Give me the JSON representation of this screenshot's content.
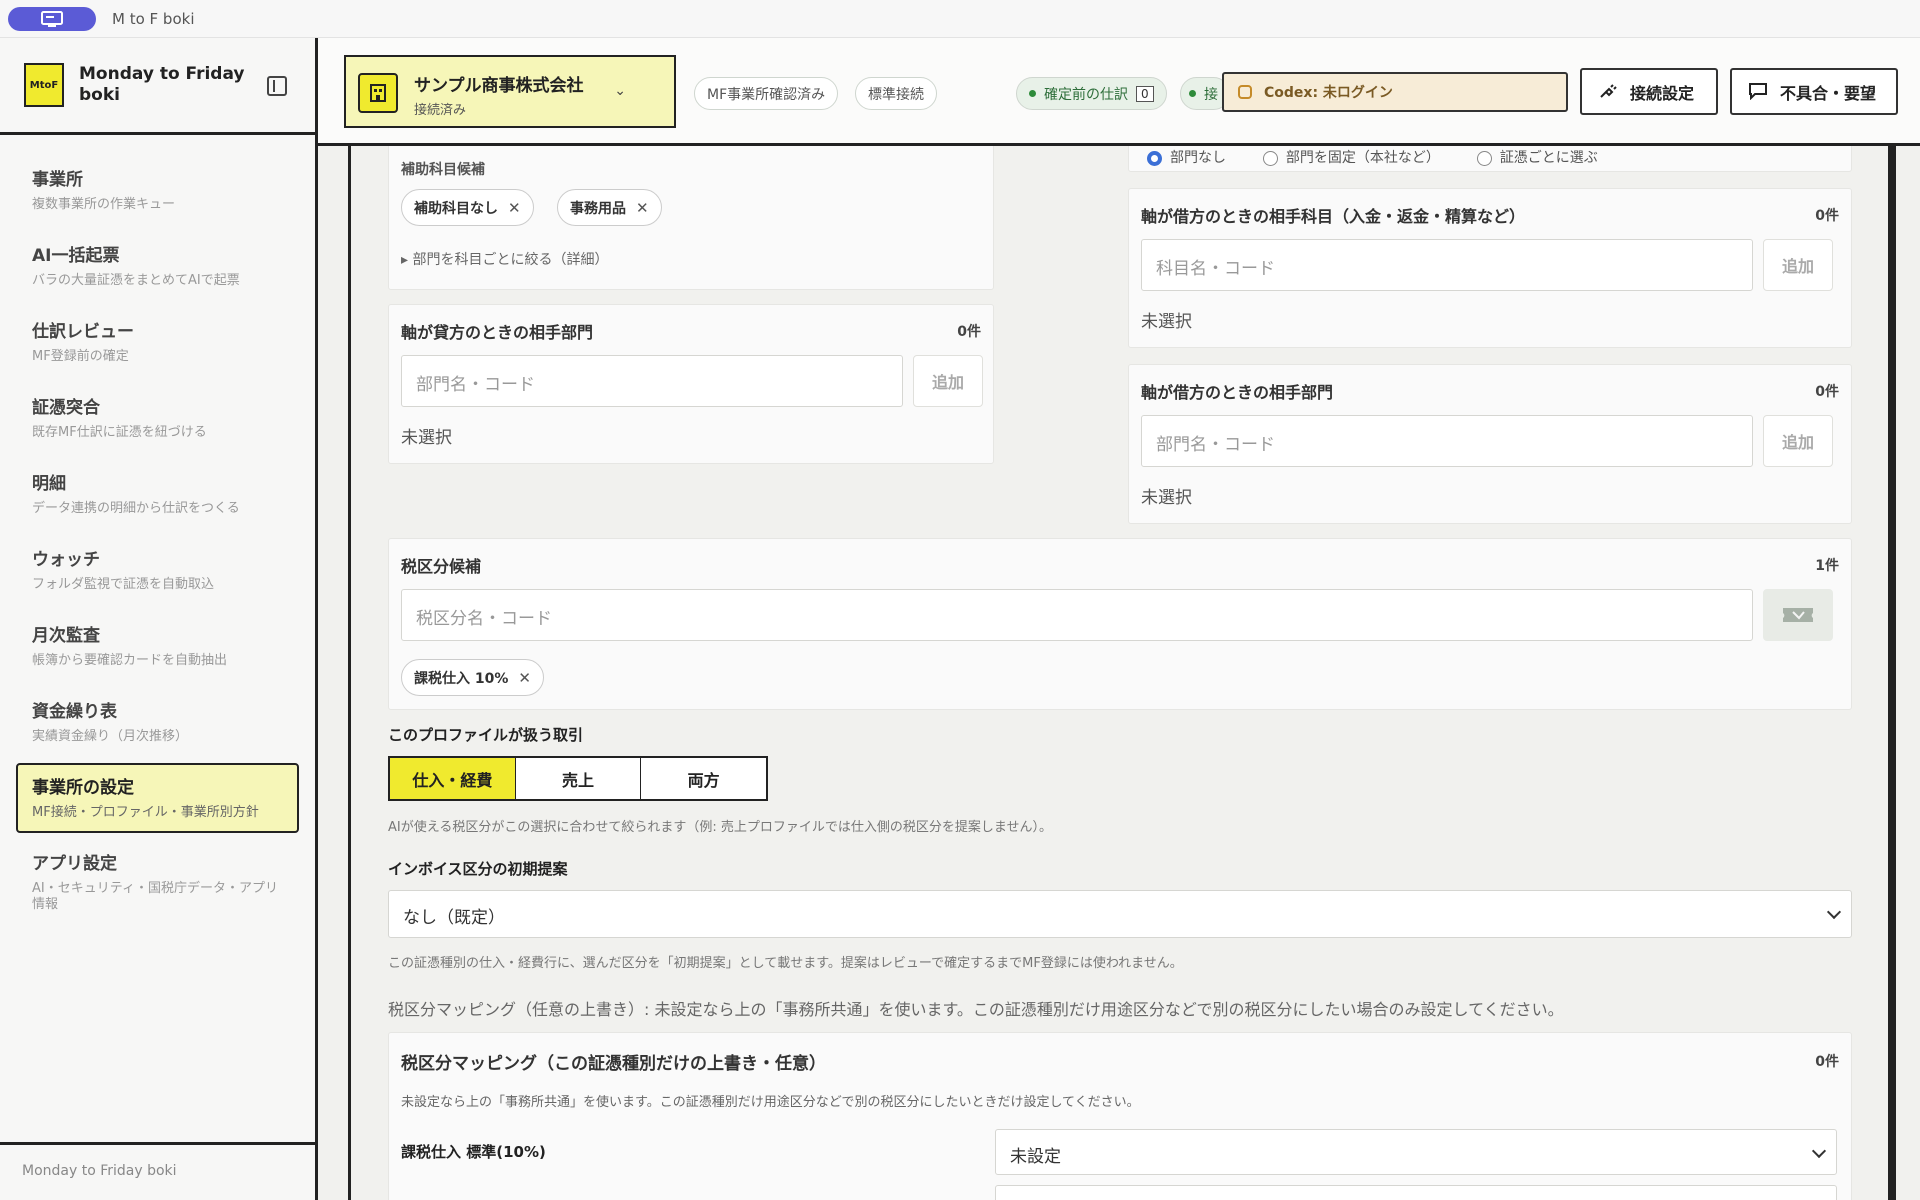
{
  "app": {
    "title": "M to F boki"
  },
  "sidebar": {
    "logo_text": "MtoF",
    "title": "Monday to Friday boki",
    "items": [
      {
        "label": "事業所",
        "sub": "複数事業所の作業キュー"
      },
      {
        "label": "AI一括起票",
        "sub": "バラの大量証憑をまとめてAIで起票"
      },
      {
        "label": "仕訳レビュー",
        "sub": "MF登録前の確定"
      },
      {
        "label": "証憑突合",
        "sub": "既存MF仕訳に証憑を紐づける"
      },
      {
        "label": "明細",
        "sub": "データ連携の明細から仕訳をつくる"
      },
      {
        "label": "ウォッチ",
        "sub": "フォルダ監視で証憑を自動取込"
      },
      {
        "label": "月次監査",
        "sub": "帳簿から要確認カードを自動抽出"
      },
      {
        "label": "資金繰り表",
        "sub": "実績資金繰り（月次推移）"
      },
      {
        "label": "事業所の設定",
        "sub": "MF接続・プロファイル・事業所別方針"
      },
      {
        "label": "アプリ設定",
        "sub": "AI・セキュリティ・国税庁データ・アプリ情報"
      }
    ],
    "footer": "Monday to Friday boki"
  },
  "header": {
    "company_name": "サンプル商事株式会社",
    "company_status": "接続済み",
    "pill_mf": "MF事業所確認済み",
    "pill_std": "標準接続",
    "pill_pending": "確定前の仕訳",
    "pill_pending_count": "0",
    "pill_cut": "接",
    "codex": "Codex: 未ログイン",
    "btn_connect": "接続設定",
    "btn_report": "不具合・要望"
  },
  "content": {
    "radio_options": [
      "部門なし",
      "部門を固定（本社など）",
      "証憑ごとに選ぶ"
    ],
    "sub_account_label": "補助科目候補",
    "sub_account_chips": [
      "補助科目なし",
      "事務用品"
    ],
    "dept_detail_link": "▸ 部門を科目ごとに絞る（詳細）",
    "credit_dept": {
      "label": "軸が貸方のときの相手部門",
      "count": "0件",
      "placeholder": "部門名・コード",
      "add": "追加",
      "unselected": "未選択"
    },
    "debit_account": {
      "label": "軸が借方のときの相手科目（入金・返金・精算など）",
      "count": "0件",
      "placeholder": "科目名・コード",
      "add": "追加",
      "unselected": "未選択"
    },
    "debit_dept": {
      "label": "軸が借方のときの相手部門",
      "count": "0件",
      "placeholder": "部門名・コード",
      "add": "追加",
      "unselected": "未選択"
    },
    "tax_candidates": {
      "label": "税区分候補",
      "count": "1件",
      "placeholder": "税区分名・コード",
      "chips": [
        "課税仕入 10%"
      ]
    },
    "profile_tx_label": "このプロファイルが扱う取引",
    "segments": [
      "仕入・経費",
      "売上",
      "両方"
    ],
    "segment_note": "AIが使える税区分がこの選択に合わせて絞られます（例: 売上プロファイルでは仕入側の税区分を提案しません）。",
    "invoice_label": "インボイス区分の初期提案",
    "invoice_value": "なし（既定）",
    "invoice_note": "この証憑種別の仕入・経費行に、選んだ区分を「初期提案」として載せます。提案はレビューで確定するまでMF登録には使われません。",
    "mapping_note": "税区分マッピング（任意の上書き）: 未設定なら上の「事務所共通」を使います。この証憑種別だけ用途区分などで別の税区分にしたい場合のみ設定してください。",
    "mapping_card": {
      "label": "税区分マッピング（この証憑種別だけの上書き・任意）",
      "count": "0件",
      "desc": "未設定なら上の「事務所共通」を使います。この証憑種別だけ用途区分などで別の税区分にしたいときだけ設定してください。",
      "row_label": "課税仕入 標準(10%)",
      "row_value": "未設定"
    }
  }
}
